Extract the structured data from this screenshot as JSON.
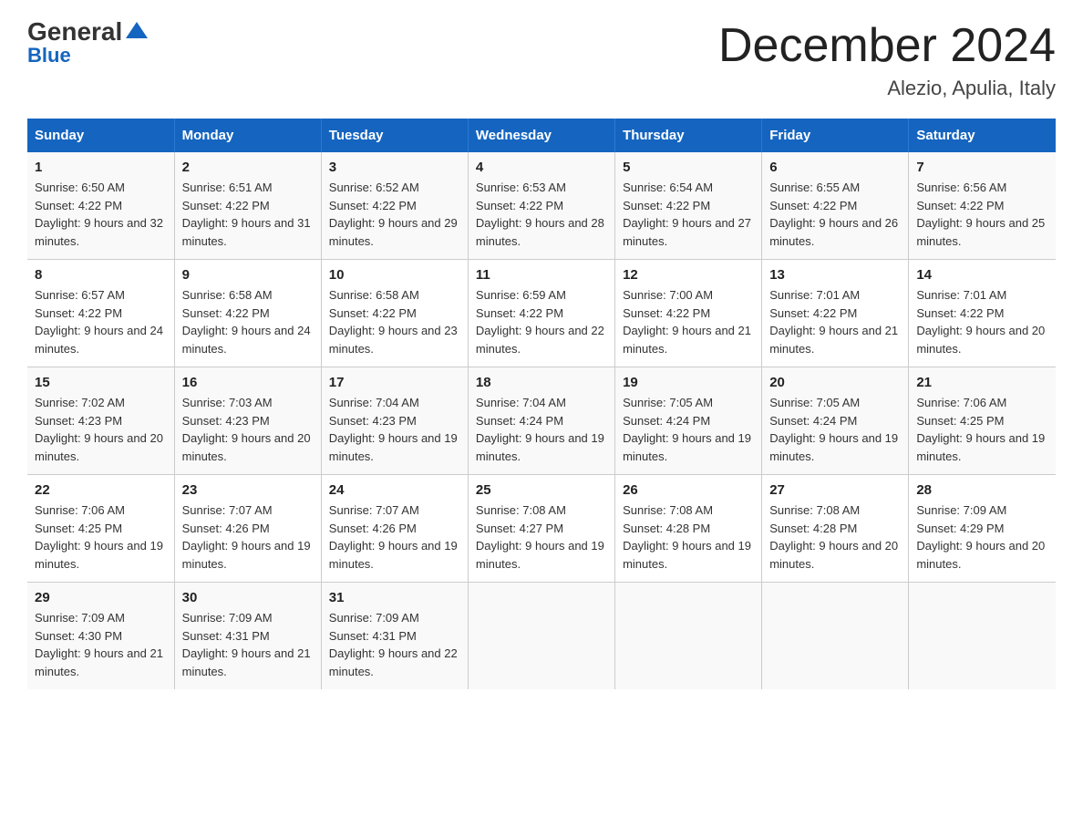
{
  "header": {
    "logo_part1": "General",
    "logo_part2": "Blue",
    "title": "December 2024",
    "subtitle": "Alezio, Apulia, Italy"
  },
  "days_of_week": [
    "Sunday",
    "Monday",
    "Tuesday",
    "Wednesday",
    "Thursday",
    "Friday",
    "Saturday"
  ],
  "weeks": [
    [
      {
        "day": "1",
        "sunrise": "Sunrise: 6:50 AM",
        "sunset": "Sunset: 4:22 PM",
        "daylight": "Daylight: 9 hours and 32 minutes."
      },
      {
        "day": "2",
        "sunrise": "Sunrise: 6:51 AM",
        "sunset": "Sunset: 4:22 PM",
        "daylight": "Daylight: 9 hours and 31 minutes."
      },
      {
        "day": "3",
        "sunrise": "Sunrise: 6:52 AM",
        "sunset": "Sunset: 4:22 PM",
        "daylight": "Daylight: 9 hours and 29 minutes."
      },
      {
        "day": "4",
        "sunrise": "Sunrise: 6:53 AM",
        "sunset": "Sunset: 4:22 PM",
        "daylight": "Daylight: 9 hours and 28 minutes."
      },
      {
        "day": "5",
        "sunrise": "Sunrise: 6:54 AM",
        "sunset": "Sunset: 4:22 PM",
        "daylight": "Daylight: 9 hours and 27 minutes."
      },
      {
        "day": "6",
        "sunrise": "Sunrise: 6:55 AM",
        "sunset": "Sunset: 4:22 PM",
        "daylight": "Daylight: 9 hours and 26 minutes."
      },
      {
        "day": "7",
        "sunrise": "Sunrise: 6:56 AM",
        "sunset": "Sunset: 4:22 PM",
        "daylight": "Daylight: 9 hours and 25 minutes."
      }
    ],
    [
      {
        "day": "8",
        "sunrise": "Sunrise: 6:57 AM",
        "sunset": "Sunset: 4:22 PM",
        "daylight": "Daylight: 9 hours and 24 minutes."
      },
      {
        "day": "9",
        "sunrise": "Sunrise: 6:58 AM",
        "sunset": "Sunset: 4:22 PM",
        "daylight": "Daylight: 9 hours and 24 minutes."
      },
      {
        "day": "10",
        "sunrise": "Sunrise: 6:58 AM",
        "sunset": "Sunset: 4:22 PM",
        "daylight": "Daylight: 9 hours and 23 minutes."
      },
      {
        "day": "11",
        "sunrise": "Sunrise: 6:59 AM",
        "sunset": "Sunset: 4:22 PM",
        "daylight": "Daylight: 9 hours and 22 minutes."
      },
      {
        "day": "12",
        "sunrise": "Sunrise: 7:00 AM",
        "sunset": "Sunset: 4:22 PM",
        "daylight": "Daylight: 9 hours and 21 minutes."
      },
      {
        "day": "13",
        "sunrise": "Sunrise: 7:01 AM",
        "sunset": "Sunset: 4:22 PM",
        "daylight": "Daylight: 9 hours and 21 minutes."
      },
      {
        "day": "14",
        "sunrise": "Sunrise: 7:01 AM",
        "sunset": "Sunset: 4:22 PM",
        "daylight": "Daylight: 9 hours and 20 minutes."
      }
    ],
    [
      {
        "day": "15",
        "sunrise": "Sunrise: 7:02 AM",
        "sunset": "Sunset: 4:23 PM",
        "daylight": "Daylight: 9 hours and 20 minutes."
      },
      {
        "day": "16",
        "sunrise": "Sunrise: 7:03 AM",
        "sunset": "Sunset: 4:23 PM",
        "daylight": "Daylight: 9 hours and 20 minutes."
      },
      {
        "day": "17",
        "sunrise": "Sunrise: 7:04 AM",
        "sunset": "Sunset: 4:23 PM",
        "daylight": "Daylight: 9 hours and 19 minutes."
      },
      {
        "day": "18",
        "sunrise": "Sunrise: 7:04 AM",
        "sunset": "Sunset: 4:24 PM",
        "daylight": "Daylight: 9 hours and 19 minutes."
      },
      {
        "day": "19",
        "sunrise": "Sunrise: 7:05 AM",
        "sunset": "Sunset: 4:24 PM",
        "daylight": "Daylight: 9 hours and 19 minutes."
      },
      {
        "day": "20",
        "sunrise": "Sunrise: 7:05 AM",
        "sunset": "Sunset: 4:24 PM",
        "daylight": "Daylight: 9 hours and 19 minutes."
      },
      {
        "day": "21",
        "sunrise": "Sunrise: 7:06 AM",
        "sunset": "Sunset: 4:25 PM",
        "daylight": "Daylight: 9 hours and 19 minutes."
      }
    ],
    [
      {
        "day": "22",
        "sunrise": "Sunrise: 7:06 AM",
        "sunset": "Sunset: 4:25 PM",
        "daylight": "Daylight: 9 hours and 19 minutes."
      },
      {
        "day": "23",
        "sunrise": "Sunrise: 7:07 AM",
        "sunset": "Sunset: 4:26 PM",
        "daylight": "Daylight: 9 hours and 19 minutes."
      },
      {
        "day": "24",
        "sunrise": "Sunrise: 7:07 AM",
        "sunset": "Sunset: 4:26 PM",
        "daylight": "Daylight: 9 hours and 19 minutes."
      },
      {
        "day": "25",
        "sunrise": "Sunrise: 7:08 AM",
        "sunset": "Sunset: 4:27 PM",
        "daylight": "Daylight: 9 hours and 19 minutes."
      },
      {
        "day": "26",
        "sunrise": "Sunrise: 7:08 AM",
        "sunset": "Sunset: 4:28 PM",
        "daylight": "Daylight: 9 hours and 19 minutes."
      },
      {
        "day": "27",
        "sunrise": "Sunrise: 7:08 AM",
        "sunset": "Sunset: 4:28 PM",
        "daylight": "Daylight: 9 hours and 20 minutes."
      },
      {
        "day": "28",
        "sunrise": "Sunrise: 7:09 AM",
        "sunset": "Sunset: 4:29 PM",
        "daylight": "Daylight: 9 hours and 20 minutes."
      }
    ],
    [
      {
        "day": "29",
        "sunrise": "Sunrise: 7:09 AM",
        "sunset": "Sunset: 4:30 PM",
        "daylight": "Daylight: 9 hours and 21 minutes."
      },
      {
        "day": "30",
        "sunrise": "Sunrise: 7:09 AM",
        "sunset": "Sunset: 4:31 PM",
        "daylight": "Daylight: 9 hours and 21 minutes."
      },
      {
        "day": "31",
        "sunrise": "Sunrise: 7:09 AM",
        "sunset": "Sunset: 4:31 PM",
        "daylight": "Daylight: 9 hours and 22 minutes."
      },
      null,
      null,
      null,
      null
    ]
  ]
}
